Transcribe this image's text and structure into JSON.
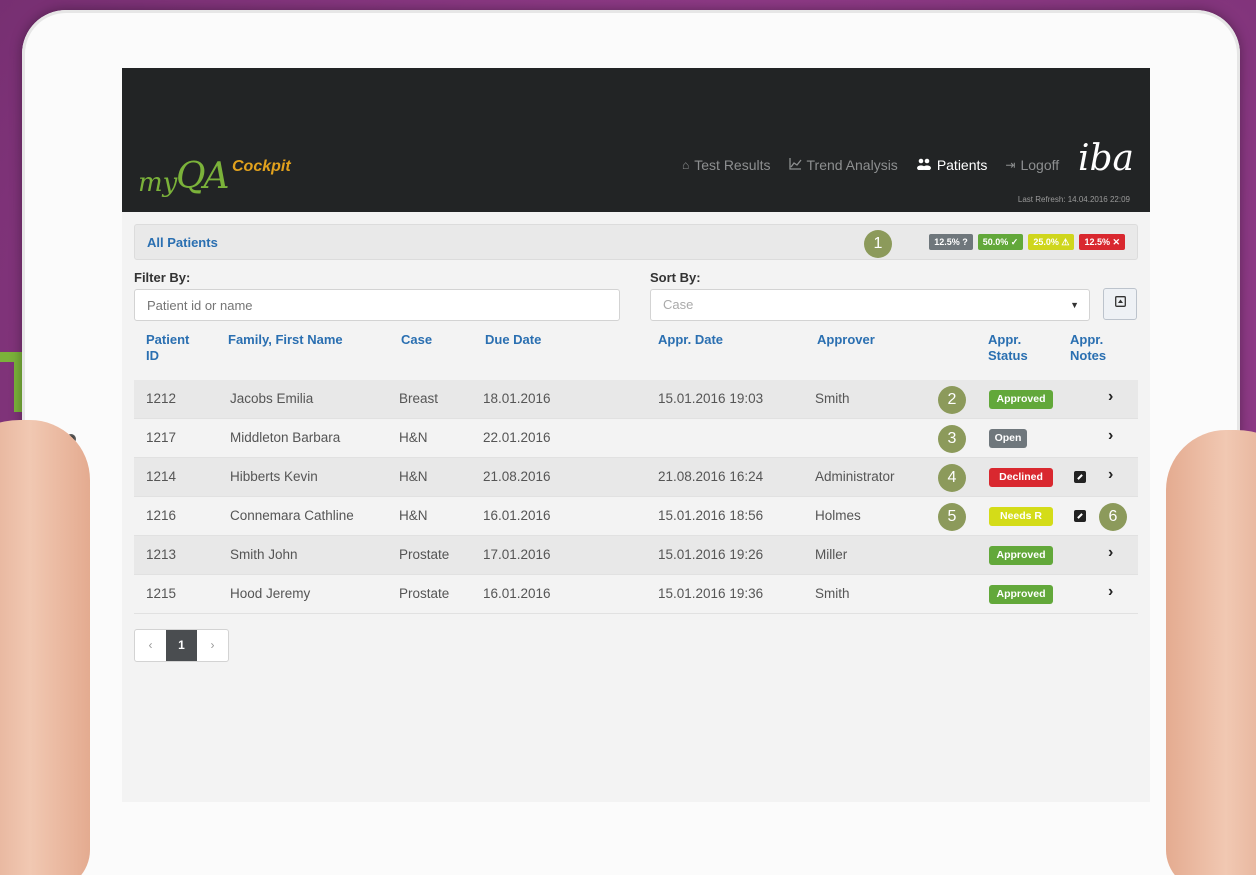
{
  "app": {
    "logo": {
      "my": "my",
      "qa": "QA",
      "cockpit": "Cockpit"
    },
    "brand": "iba",
    "last_refresh": "Last Refresh: 14.04.2016 22:09"
  },
  "nav": {
    "items": [
      {
        "label": "Test Results",
        "icon": "home-icon"
      },
      {
        "label": "Trend Analysis",
        "icon": "line-chart-icon"
      },
      {
        "label": "Patients",
        "icon": "users-icon",
        "active": true
      },
      {
        "label": "Logoff",
        "icon": "logout-icon"
      }
    ]
  },
  "panel": {
    "title": "All Patients",
    "summary": [
      {
        "text": "12.5% ?",
        "color": "#6f777c"
      },
      {
        "text": "50.0% ✓",
        "color": "#62a83a"
      },
      {
        "text": "25.0% ⚠",
        "color": "#cfd61c"
      },
      {
        "text": "12.5% ✕",
        "color": "#d9282f"
      }
    ]
  },
  "filter": {
    "label": "Filter By:",
    "placeholder": "Patient id or name"
  },
  "sort": {
    "label": "Sort By:",
    "value": "Case"
  },
  "callouts": [
    "1",
    "2",
    "3",
    "4",
    "5",
    "6"
  ],
  "table": {
    "headers": {
      "patient_id": [
        "Patient",
        "ID"
      ],
      "name": "Family, First Name",
      "case": "Case",
      "due_date": "Due Date",
      "appr_date": "Appr. Date",
      "approver": "Approver",
      "appr_status": [
        "Appr.",
        "Status"
      ],
      "appr_notes": [
        "Appr.",
        "Notes"
      ]
    },
    "rows": [
      {
        "id": "1212",
        "name": "Jacobs Emilia",
        "case": "Breast",
        "due": "18.01.2016",
        "appr_date": "15.01.2016 19:03",
        "approver": "Smith",
        "status": "Approved"
      },
      {
        "id": "1217",
        "name": "Middleton Barbara",
        "case": "H&N",
        "due": "22.01.2016",
        "appr_date": "",
        "approver": "",
        "status": "Open"
      },
      {
        "id": "1214",
        "name": "Hibberts Kevin",
        "case": "H&N",
        "due": "21.08.2016",
        "appr_date": "21.08.2016 16:24",
        "approver": "Administrator",
        "status": "Declined"
      },
      {
        "id": "1216",
        "name": "Connemara Cathline",
        "case": "H&N",
        "due": "16.01.2016",
        "appr_date": "15.01.2016 18:56",
        "approver": "Holmes",
        "status": "Needs R"
      },
      {
        "id": "1213",
        "name": "Smith John",
        "case": "Prostate",
        "due": "17.01.2016",
        "appr_date": "15.01.2016 19:26",
        "approver": "Miller",
        "status": "Approved"
      },
      {
        "id": "1215",
        "name": "Hood Jeremy",
        "case": "Prostate",
        "due": "16.01.2016",
        "appr_date": "15.01.2016 19:36",
        "approver": "Smith",
        "status": "Approved"
      }
    ]
  },
  "pagination": {
    "prev": "‹",
    "current": "1",
    "next": "›"
  }
}
